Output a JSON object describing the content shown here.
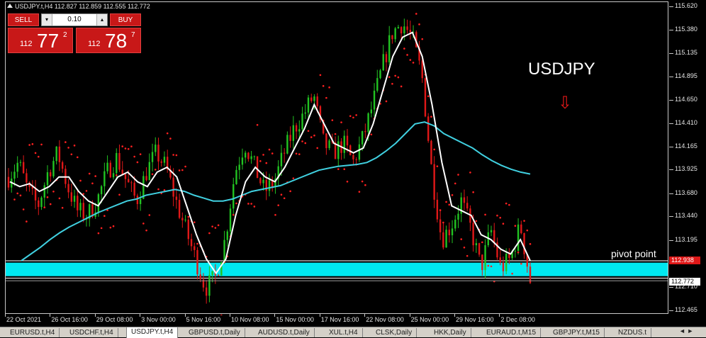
{
  "header": {
    "symbol_line": "USDJPY.t,H4  112.827 112.859 112.555 112.772"
  },
  "trade_panel": {
    "sell_label": "SELL",
    "buy_label": "BUY",
    "lot_value": "0.10",
    "lot_down": "▾",
    "lot_up": "▴",
    "sell_quote": {
      "small": "112",
      "big": "77",
      "sup": "2"
    },
    "buy_quote": {
      "small": "112",
      "big": "78",
      "sup": "7"
    }
  },
  "annotations": {
    "symbol_title": "USDJPY",
    "pivot_label": "pivot point",
    "arrow": "⇩"
  },
  "price_axis": {
    "labels": [
      "115.620",
      "115.380",
      "115.135",
      "114.895",
      "114.650",
      "114.410",
      "114.165",
      "113.925",
      "113.680",
      "113.440",
      "113.195",
      "112.955",
      "112.710",
      "112.465"
    ],
    "pivot_tag": "112.938",
    "current_tag": "112.772"
  },
  "time_axis": {
    "labels": [
      "22 Oct 2021",
      "26 Oct 16:00",
      "29 Oct 08:00",
      "3 Nov 00:00",
      "5 Nov 16:00",
      "10 Nov 08:00",
      "15 Nov 00:00",
      "17 Nov 16:00",
      "22 Nov 08:00",
      "25 Nov 00:00",
      "29 Nov 16:00",
      "2 Dec 08:00"
    ]
  },
  "tabs": [
    "EURUSD.t,H4",
    "USDCHF.t,H4",
    "USDJPY.t,H4",
    "GBPUSD.t,Daily",
    "AUDUSD.t,Daily",
    "XUL.t,H4",
    "CLSK,Daily",
    "HKK,Daily",
    "EURAUD.t,M15",
    "GBPJPY.t,M15",
    "NZDUS.t"
  ],
  "active_tab": 2,
  "colors": {
    "bull": "#22c322",
    "bear": "#e01818",
    "sar": "#ff2020",
    "fast_ma": "#ffffff",
    "slow_ma": "#40d0e0",
    "pivot_zone": "#00e8f0"
  },
  "chart_data": {
    "type": "candlestick",
    "symbol": "USDJPY.t",
    "timeframe": "H4",
    "ohlc_current": {
      "open": 112.827,
      "high": 112.859,
      "low": 112.555,
      "close": 112.772
    },
    "ylim": [
      112.465,
      115.62
    ],
    "pivot_zone": [
      112.82,
      112.96
    ],
    "close_path": [
      113.85,
      114.0,
      113.7,
      113.55,
      113.9,
      114.1,
      113.75,
      113.5,
      113.45,
      113.6,
      113.9,
      114.05,
      113.8,
      113.6,
      113.9,
      114.1,
      113.95,
      113.6,
      113.3,
      113.0,
      112.7,
      112.8,
      113.2,
      113.9,
      114.2,
      113.95,
      113.7,
      113.8,
      114.1,
      114.35,
      114.5,
      114.7,
      114.2,
      114.1,
      114.2,
      114.0,
      114.25,
      114.6,
      115.0,
      115.35,
      115.45,
      115.3,
      114.9,
      113.9,
      113.2,
      113.35,
      113.6,
      113.3,
      112.9,
      113.3,
      112.9,
      113.0,
      113.35,
      112.77
    ],
    "fast_ma": [
      113.8,
      113.75,
      113.78,
      113.7,
      113.75,
      113.85,
      113.85,
      113.7,
      113.6,
      113.55,
      113.7,
      113.85,
      113.9,
      113.8,
      113.75,
      113.9,
      113.95,
      113.85,
      113.55,
      113.25,
      113.0,
      112.85,
      113.0,
      113.45,
      113.8,
      113.95,
      113.85,
      113.8,
      113.95,
      114.15,
      114.35,
      114.6,
      114.4,
      114.2,
      114.15,
      114.1,
      114.15,
      114.4,
      114.75,
      115.1,
      115.3,
      115.35,
      115.1,
      114.6,
      114.0,
      113.55,
      113.5,
      113.45,
      113.25,
      113.2,
      113.1,
      113.05,
      113.2,
      112.98
    ],
    "slow_ma": [
      112.98,
      113.05,
      113.12,
      113.2,
      113.27,
      113.33,
      113.38,
      113.43,
      113.48,
      113.52,
      113.56,
      113.6,
      113.62,
      113.66,
      113.68,
      113.7,
      113.72,
      113.7,
      113.66,
      113.63,
      113.6,
      113.6,
      113.62,
      113.66,
      113.7,
      113.72,
      113.74,
      113.76,
      113.8,
      113.84,
      113.88,
      113.92,
      113.94,
      113.96,
      113.97,
      113.98,
      114.0,
      114.05,
      114.12,
      114.2,
      114.3,
      114.4,
      114.42,
      114.38,
      114.3,
      114.25,
      114.2,
      114.15,
      114.08,
      114.02,
      113.97,
      113.93,
      113.9,
      113.88
    ]
  }
}
